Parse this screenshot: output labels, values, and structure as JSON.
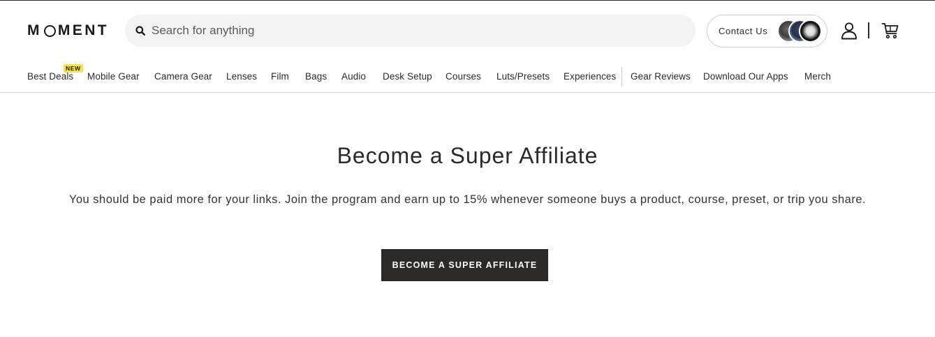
{
  "header": {
    "logo_text_left": "M",
    "logo_text_right": "MENT",
    "search": {
      "placeholder": "Search for anything",
      "icon": "search-icon"
    },
    "contact": {
      "label": "Contact Us",
      "avatars": [
        "support-avatar-1",
        "support-avatar-2",
        "support-avatar-3"
      ]
    },
    "icons": {
      "account": "user-icon",
      "cart": "cart-icon"
    }
  },
  "nav": {
    "badge": "NEW",
    "items": [
      {
        "label": "Best Deals"
      },
      {
        "label": "Mobile Gear"
      },
      {
        "label": "Camera Gear"
      },
      {
        "label": "Lenses"
      },
      {
        "label": "Film"
      },
      {
        "label": "Bags"
      },
      {
        "label": "Audio"
      },
      {
        "label": "Desk Setup"
      },
      {
        "label": "Courses"
      },
      {
        "label": "Luts/Presets"
      },
      {
        "label": "Experiences"
      },
      {
        "label": "Gear Reviews"
      },
      {
        "label": "Download Our Apps"
      },
      {
        "label": "Merch"
      }
    ]
  },
  "hero": {
    "title": "Become a Super Affiliate",
    "text": "You should be paid more for your links. Join the program and earn up to 15% whenever someone buys a product, course, preset, or trip you share.",
    "cta_label": "BECOME A SUPER AFFILIATE"
  },
  "colors": {
    "text": "#2a2a2a",
    "search_bg": "#f3f3f3",
    "badge_bg": "#f7e14b",
    "cta_bg": "#2b2a28"
  }
}
